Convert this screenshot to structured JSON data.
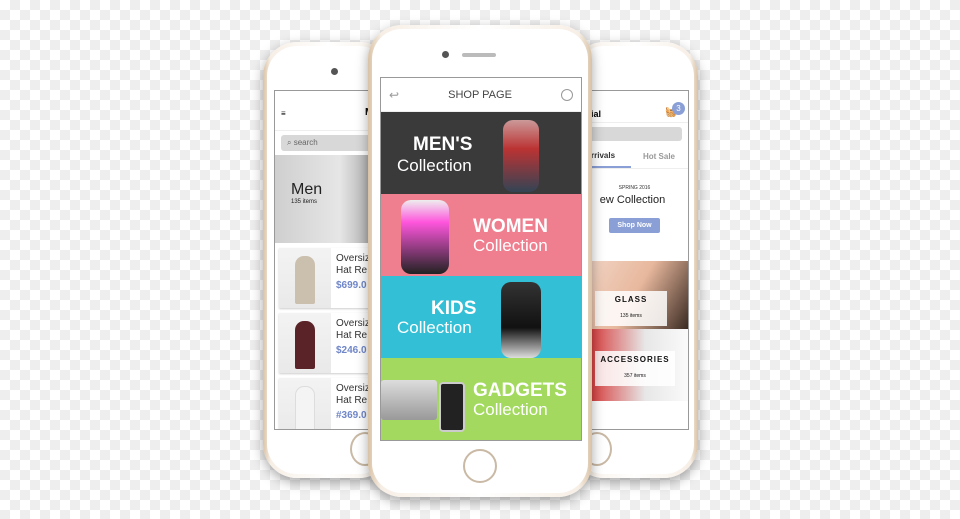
{
  "left_screen": {
    "title_partial": "M",
    "search_placeholder": "search",
    "category": {
      "title": "Men",
      "count": "135 items"
    },
    "products": [
      {
        "name1": "Oversiz",
        "name2": "Hat Re",
        "price": "$699.0",
        "color": "#cbbfae"
      },
      {
        "name1": "Oversiz",
        "name2": "Hat Re",
        "price": "$246.0",
        "color": "#5a2328"
      },
      {
        "name1": "Oversiz",
        "name2": "Hat Re",
        "price": "#369.0",
        "color": "#f4f4f4"
      }
    ]
  },
  "center_screen": {
    "title": "SHOP PAGE",
    "back_icon": "back-arrow-icon",
    "user_icon": "user-icon",
    "banners": [
      {
        "line1": "MEN'S",
        "line2": "Collection",
        "color": "#3a3a3a"
      },
      {
        "line1": "WOMEN",
        "line2": "Collection",
        "color": "#ef7f8f"
      },
      {
        "line1": "KIDS",
        "line2": "Collection",
        "color": "#33c0d6"
      },
      {
        "line1": "GADGETS",
        "line2": "Collection",
        "color": "#a2d95e"
      }
    ]
  },
  "right_screen": {
    "title_partial": "ial",
    "cart_badge": "3",
    "tabs": [
      "rrivals",
      "Hot Sale"
    ],
    "promo": {
      "season": "SPRING 2016",
      "title": "ew Collection",
      "button": "Shop Now"
    },
    "tiles": [
      {
        "title": "GLASS",
        "count": "135 items"
      },
      {
        "title": "ACCESSORIES",
        "count": "357 items"
      }
    ],
    "accent": "#8a9fd6"
  }
}
